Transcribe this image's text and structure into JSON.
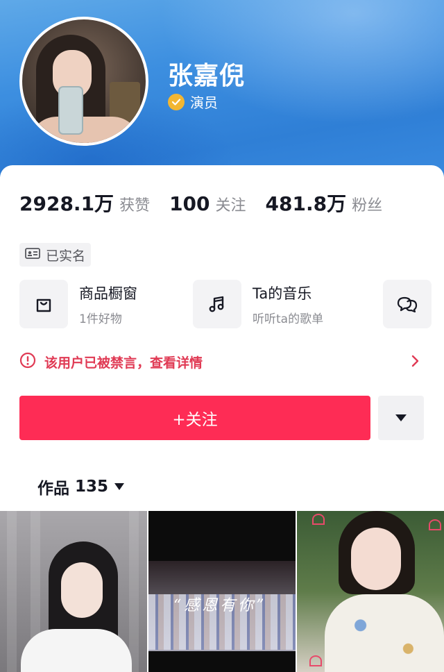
{
  "profile": {
    "name": "张嘉倪",
    "verify_label": "演员",
    "colors": {
      "accent": "#fe2c55",
      "verify": "#f2b632",
      "warning": "#e03a54",
      "header": "#3d8fe0"
    }
  },
  "stats": {
    "likes": {
      "value": "2928.1万",
      "label": "获赞"
    },
    "following": {
      "value": "100",
      "label": "关注"
    },
    "followers": {
      "value": "481.8万",
      "label": "粉丝"
    }
  },
  "realname": {
    "label": "已实名",
    "icon": "id-card-icon"
  },
  "services": [
    {
      "title": "商品橱窗",
      "subtitle": "1件好物",
      "icon": "shopping-bag-icon"
    },
    {
      "title": "Ta的音乐",
      "subtitle": "听听ta的歌单",
      "icon": "music-note-icon"
    },
    {
      "title": "",
      "subtitle": "",
      "icon": "chat-bubbles-icon"
    }
  ],
  "banned_notice": {
    "text": "该用户已被禁言，查看详情",
    "icon": "alert-circle-icon"
  },
  "actions": {
    "follow_label": "+关注",
    "more_icon": "triangle-down-icon"
  },
  "works": {
    "label": "作品",
    "count": "135"
  },
  "videos": [
    {
      "caption": ""
    },
    {
      "caption": "“感恩有你”"
    },
    {
      "caption": ""
    }
  ]
}
